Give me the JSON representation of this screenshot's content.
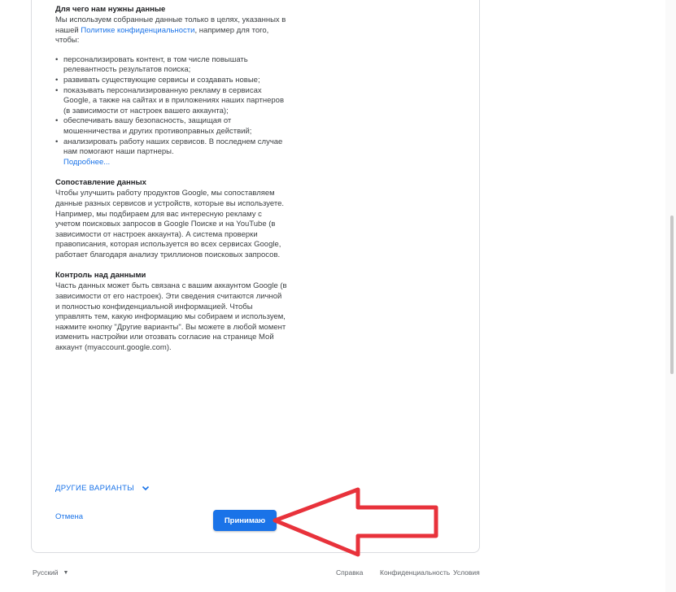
{
  "sections": {
    "why": {
      "title": "Для чего нам нужны данные",
      "intro_1": "Мы используем собранные данные только в целях, указанных в нашей",
      "intro_link": "Политике конфиденциальности",
      "intro_2": ", например для того, чтобы:",
      "bullets": [
        "персонализировать контент, в том числе повышать релевантность результатов поиска;",
        "развивать существующие сервисы и создавать новые;",
        "показывать персонализированную рекламу в сервисах Google, а также на сайтах и в приложениях наших партнеров (в зависимости от настроек вашего аккаунта);",
        "обеспечивать вашу безопасность, защищая от мошенничества и других противоправных действий;",
        "анализировать работу наших сервисов. В последнем случае нам помогают наши партнеры."
      ],
      "more_link": "Подробнее..."
    },
    "matching": {
      "title": "Сопоставление данных",
      "text": "Чтобы улучшить работу продуктов Google, мы сопоставляем данные разных сервисов и устройств, которые вы используете. Например, мы подбираем для вас интересную рекламу с учетом поисковых запросов в Google Поиске и на YouTube (в зависимости от настроек аккаунта). А система проверки правописания, которая используется во всех сервисах Google, работает благодаря анализу триллионов поисковых запросов."
    },
    "control": {
      "title": "Контроль над данными",
      "text": "Часть данных может быть связана с вашим аккаунтом Google (в зависимости от его настроек). Эти сведения считаются личной и полностью конфиденциальной информацией. Чтобы управлять тем, какую информацию мы собираем и используем, нажмите кнопку \"Другие варианты\". Вы можете в любой момент изменить настройки или отозвать согласие на странице Мой аккаунт (myaccount.google.com)."
    }
  },
  "actions": {
    "more_options": "ДРУГИЕ ВАРИАНТЫ",
    "cancel": "Отмена",
    "accept": "Принимаю"
  },
  "footer": {
    "language": "Русский",
    "help": "Справка",
    "privacy": "Конфиденциальность",
    "terms": "Условия"
  },
  "colors": {
    "accent": "#1a73e8",
    "annotation_arrow": "#e8323b"
  },
  "icons": {
    "more_options": "chevron-down-icon",
    "language": "caret-down-icon",
    "annotation": "left-arrow-annotation"
  }
}
